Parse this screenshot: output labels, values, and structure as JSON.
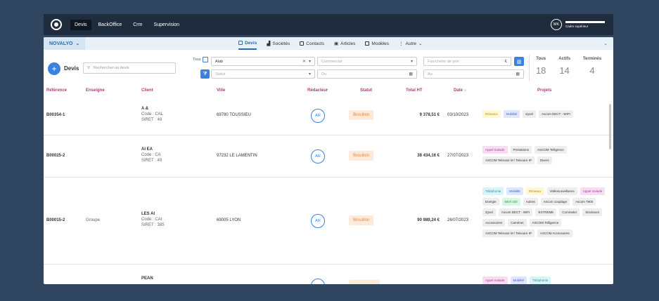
{
  "topbar": {
    "nav": [
      "Devis",
      "BackOffice",
      "Crm",
      "Supervision"
    ],
    "user_initials": "MK",
    "user_role": "Cadre supérieur"
  },
  "subbar": {
    "company": "NOVALYO",
    "tabs": [
      "Devis",
      "Sociétés",
      "Contacts",
      "Articles",
      "Modèles",
      "Autre"
    ]
  },
  "filters": {
    "devis_label": "Devis",
    "search_placeholder": "Rechercher un devis",
    "tous_label": "Tous",
    "client_value": "Alab",
    "statut_placeholder": "Statut",
    "commercial_placeholder": "Commercial",
    "du_placeholder": "Du",
    "fourchette_placeholder": "Fourchette de prix",
    "currency": "€",
    "au_placeholder": "Au"
  },
  "stats": [
    {
      "label": "Tous",
      "value": "18"
    },
    {
      "label": "Actifs",
      "value": "14"
    },
    {
      "label": "Terminés",
      "value": "4"
    }
  ],
  "table": {
    "headers": [
      "Référence",
      "Enseigne",
      "Client",
      "Ville",
      "Rédacteur",
      "Statut",
      "Total HT",
      "Date",
      "Projets"
    ],
    "rows": [
      {
        "ref": "B00354-1",
        "enseigne": "",
        "client_name": "A &",
        "client_code": "Code : CAL",
        "client_siret": "SIRET : 48",
        "ville": "69780 TOUSSIEU",
        "redacteur": "AR",
        "statut": "Brouillon",
        "total": "9 378,51 €",
        "date": "03/10/2023",
        "projets": [
          "Réseaux",
          "Mobilité",
          "Zyxel",
          "Ascom DECT - WIFI"
        ]
      },
      {
        "ref": "B00025-2",
        "enseigne": "",
        "client_name": "AI EA",
        "client_code": "Code : CA",
        "client_siret": "SIRET : 49",
        "ville": "97232 LE LAMENTIN",
        "redacteur": "AR",
        "statut": "Brouillon",
        "total": "38 434,16 €",
        "date": "27/07/2023",
        "projets": [
          "Appel malade",
          "Prestations",
          "ASCOM Telligence",
          "ASCOM Telecare M / Telecare IP",
          "Divers"
        ]
      },
      {
        "ref": "B00015-2",
        "enseigne": "Groupe",
        "client_name": "LES AI",
        "client_code": "Code : CAI",
        "client_siret": "SIRET : 385",
        "ville": "69005 LYON",
        "redacteur": "AR",
        "statut": "Brouillon",
        "total": "90 989,24 €",
        "date": "26/07/2023",
        "projets": [
          "Téléphonie",
          "Mobilité",
          "Réseaux",
          "Vidéosurveillance",
          "Appel malade",
          "Energie",
          "Mitel 400",
          "Autres",
          "Ascom couplage",
          "Ascom T900",
          "Zyxel",
          "Ascom DECT - WIFI",
          "EXTREME",
          "Commeter",
          "Stockeurs",
          "Accessoires",
          "Caméras",
          "ASCOM Telligence",
          "ASCOM Telecare M / Telecare IP",
          "ASCOM Accessoires"
        ]
      },
      {
        "ref": "",
        "enseigne": "",
        "client_name": "PEAN",
        "client_code": "",
        "client_siret": "",
        "ville": "",
        "redacteur": "",
        "statut": "",
        "total": "",
        "date": "",
        "projets": [
          "Appel malade",
          "Mobilité",
          "Téléphonie"
        ]
      }
    ]
  }
}
